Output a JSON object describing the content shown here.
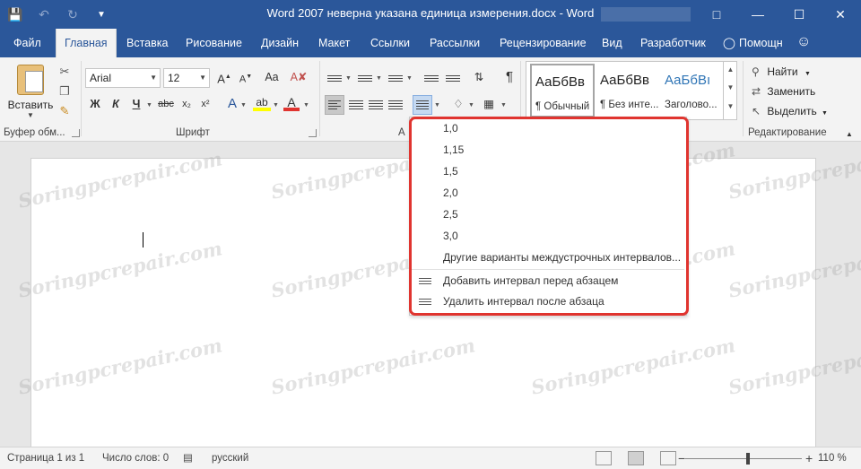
{
  "window": {
    "title": "Word 2007 неверна указана единица измерения.docx - Word"
  },
  "tabs": [
    {
      "label": "Файл"
    },
    {
      "label": "Главная"
    },
    {
      "label": "Вставка"
    },
    {
      "label": "Рисование"
    },
    {
      "label": "Дизайн"
    },
    {
      "label": "Макет"
    },
    {
      "label": "Ссылки"
    },
    {
      "label": "Рассылки"
    },
    {
      "label": "Рецензирование"
    },
    {
      "label": "Вид"
    },
    {
      "label": "Разработчик"
    }
  ],
  "tell_me": "Помощн",
  "ribbon": {
    "clipboard": {
      "paste_label": "Вставить",
      "group_label": "Буфер обм..."
    },
    "font": {
      "font_name": "Arial",
      "font_size": "12",
      "group_label": "Шрифт",
      "bold": "Ж",
      "italic": "К",
      "underline": "Ч",
      "strike": "abc",
      "sub": "x₂",
      "sup": "x²"
    },
    "paragraph": {
      "group_label_partial": "А"
    },
    "styles": [
      {
        "preview": "АаБбВв",
        "name": "¶ Обычный"
      },
      {
        "preview": "АаБбВв",
        "name": "¶ Без инте..."
      },
      {
        "preview": "АаБбВı",
        "name": "Заголово..."
      }
    ],
    "editing": {
      "find": "Найти",
      "replace": "Заменить",
      "select": "Выделить",
      "group_label": "Редактирование"
    }
  },
  "spacing_menu": {
    "items": [
      "1,0",
      "1,15",
      "1,5",
      "2,0",
      "2,5",
      "3,0"
    ],
    "more": "Другие варианты междустрочных интервалов...",
    "add_before": "Добавить интервал перед абзацем",
    "remove_after": "Удалить интервал после абзаца"
  },
  "watermark": "Soringpcrepair.com",
  "status": {
    "page": "Страница 1 из 1",
    "words": "Число слов: 0",
    "language": "русский",
    "zoom": "110 %"
  },
  "colors": {
    "brand": "#2b579a",
    "highlight_frame": "#e0342f"
  }
}
